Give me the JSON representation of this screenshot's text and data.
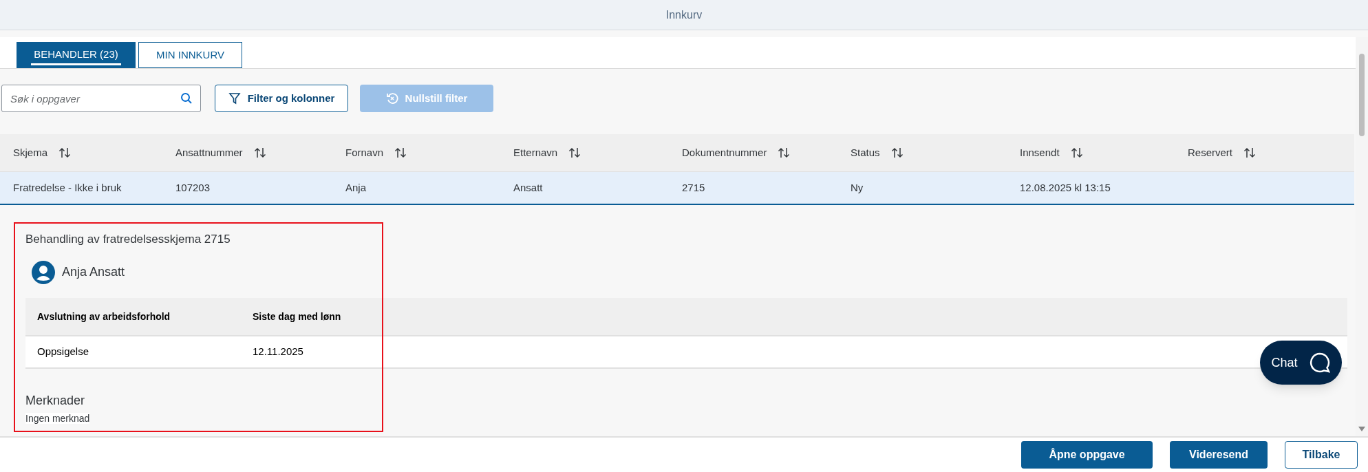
{
  "window": {
    "title": "Innkurv"
  },
  "tabs": [
    {
      "label": "BEHANDLER (23)",
      "selected": true
    },
    {
      "label": "MIN INNKURV",
      "selected": false
    }
  ],
  "search": {
    "placeholder": "Søk i oppgaver"
  },
  "toolbar_buttons": [
    {
      "label": "Filter og kolonner",
      "disabled": false
    },
    {
      "label": "Nullstill filter",
      "disabled": true
    }
  ],
  "table": {
    "columns": [
      "Skjema",
      "Ansattnummer",
      "Fornavn",
      "Etternavn",
      "Dokumentnummer",
      "Status",
      "Innsendt",
      "Reservert"
    ],
    "rows": [
      {
        "selected": true,
        "cells": [
          "Fratredelse - Ikke i bruk",
          "107203",
          "Anja",
          "Ansatt",
          "2715",
          "Ny",
          "12.08.2025 kl 13:15",
          ""
        ]
      }
    ]
  },
  "detail": {
    "title": "Behandling av fratredelsesskjema 2715",
    "person": "Anja Ansatt",
    "columns": [
      "Avslutning av arbeidsforhold",
      "Siste dag med lønn"
    ],
    "row": [
      "Oppsigelse",
      "12.11.2025"
    ],
    "notes_heading": "Merknader",
    "notes": "Ingen merknad"
  },
  "chat": {
    "label": "Chat"
  },
  "footer_buttons": [
    {
      "label": "Åpne oppgave",
      "kind": "primary"
    },
    {
      "label": "Videresend",
      "kind": "primary"
    },
    {
      "label": "Tilbake",
      "kind": "secondary"
    }
  ]
}
